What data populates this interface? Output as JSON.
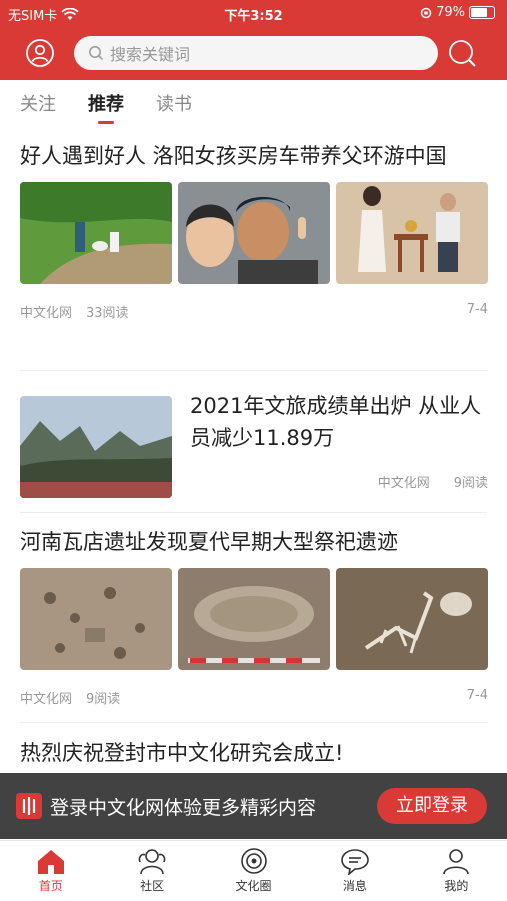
{
  "status_bar": {
    "carrier": "无SIM卡",
    "time": "下午3:52",
    "battery": "79%",
    "battery_level": 0.79
  },
  "header": {
    "search_placeholder": "搜索关键词"
  },
  "tabs": [
    {
      "label": "关注",
      "active": false
    },
    {
      "label": "推荐",
      "active": true
    },
    {
      "label": "读书",
      "active": false
    }
  ],
  "feed": [
    {
      "title": "好人遇到好人 洛阳女孩买房车带养父环游中国",
      "source": "中文化网",
      "reads": "33阅读",
      "date": "7-4"
    },
    {
      "title": "2021年文旅成绩单出炉 从业人员减少11.89万",
      "source": "中文化网",
      "reads": "9阅读"
    },
    {
      "title": "河南瓦店遗址发现夏代早期大型祭祀遗迹",
      "source": "中文化网",
      "reads": "9阅读",
      "date": "7-4"
    },
    {
      "title": "热烈庆祝登封市中文化研究会成立!"
    }
  ],
  "login_banner": {
    "text": "登录中文化网体验更多精彩内容",
    "button": "立即登录"
  },
  "bottom_nav": [
    {
      "label": "首页",
      "icon": "home-icon",
      "active": true
    },
    {
      "label": "社区",
      "icon": "community-icon",
      "active": false
    },
    {
      "label": "文化圈",
      "icon": "culture-circle-icon",
      "active": false
    },
    {
      "label": "消息",
      "icon": "message-icon",
      "active": false
    },
    {
      "label": "我的",
      "icon": "profile-icon",
      "active": false
    }
  ],
  "colors": {
    "brand": "#d93a36"
  }
}
